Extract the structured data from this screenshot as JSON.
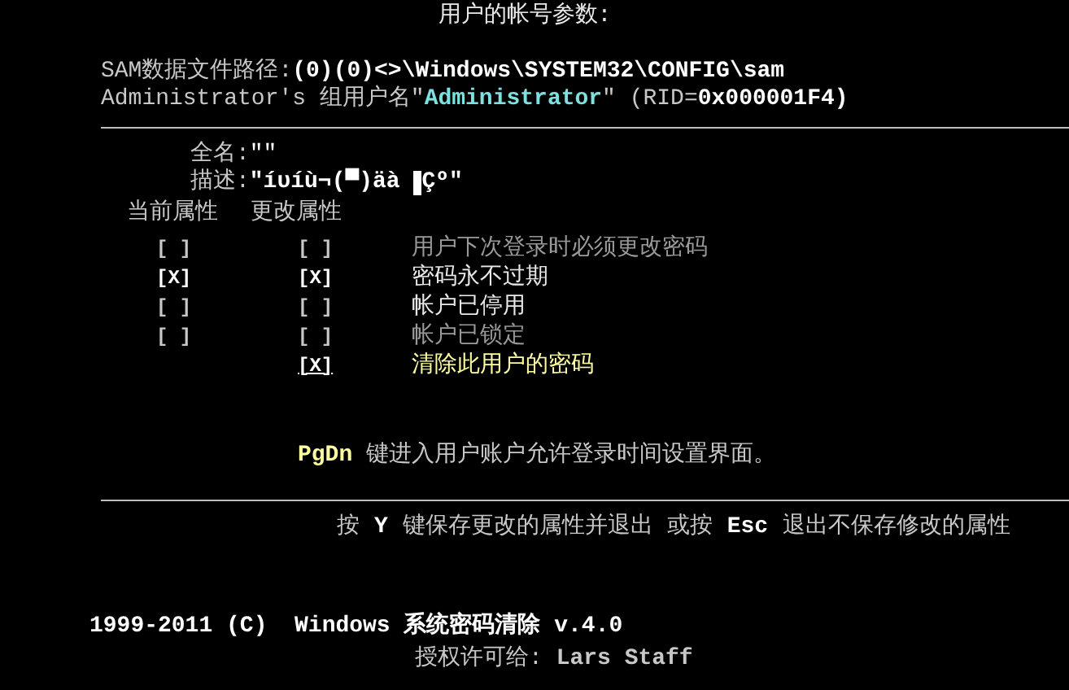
{
  "title": "用户的帐号参数:",
  "sam_path": {
    "label": "SAM数据文件路径:",
    "value": "(0)(0)<>\\Windows\\SYSTEM32\\CONFIG\\sam"
  },
  "group_line": {
    "prefix": "Administrator's 组用户名\"",
    "group": "Administrator",
    "suffix": "\" (RID=",
    "rid": "0x000001F4)"
  },
  "full_name": {
    "label": "全名:",
    "value": "\"\""
  },
  "description": {
    "label": "描述:",
    "value_before": "\"íυíù¬(▀)äà ",
    "value_after": "Çº\""
  },
  "headers": [
    "当前属性",
    "更改属性"
  ],
  "attributes": [
    {
      "kind": "toggle",
      "current": "[ ]",
      "current_checked": false,
      "change": "[ ]",
      "change_checked": false,
      "label": "用户下次登录时必须更改密码",
      "disabled": true,
      "selected": false
    },
    {
      "kind": "toggle",
      "current": "[X]",
      "current_checked": true,
      "change": "[X]",
      "change_checked": true,
      "label": "密码永不过期",
      "disabled": false,
      "selected": false
    },
    {
      "kind": "toggle",
      "current": "[ ]",
      "current_checked": false,
      "change": "[ ]",
      "change_checked": false,
      "label": "帐户已停用",
      "disabled": false,
      "selected": false
    },
    {
      "kind": "toggle",
      "current": "[ ]",
      "current_checked": false,
      "change": "[ ]",
      "change_checked": false,
      "label": "帐户已锁定",
      "disabled": true,
      "selected": false
    },
    {
      "kind": "action",
      "change": "[X]",
      "change_checked": true,
      "label": "清除此用户的密码",
      "disabled": false,
      "selected": true
    }
  ],
  "hint": {
    "key": "PgDn",
    "text": "键进入用户账户允许登录时间设置界面。"
  },
  "save_line": [
    {
      "kind": "text",
      "text": "按"
    },
    {
      "kind": "key",
      "text": "Y"
    },
    {
      "kind": "text",
      "text": "键保存更改的属性并退出 或按"
    },
    {
      "kind": "key",
      "text": "Esc"
    },
    {
      "kind": "text",
      "text": "退出不保存修改的属性"
    }
  ],
  "footer": {
    "copyright": "1999-2011 (C)  Windows 系统密码清除 v.4.0",
    "license_label": "授权许可给:",
    "licensee": "Lars Staff"
  }
}
